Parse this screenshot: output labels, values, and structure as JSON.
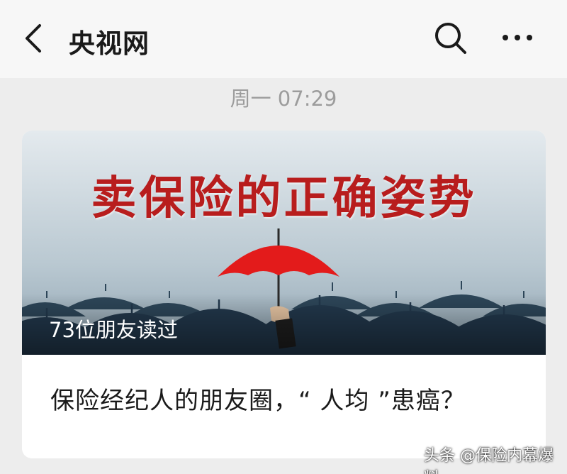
{
  "header": {
    "title": "央视网"
  },
  "icons": {
    "back": "back-chevron-icon",
    "search": "search-icon",
    "more": "more-dots-icon"
  },
  "timestamp": "周一 07:29",
  "article": {
    "cover_heading": "卖保险的正确姿势",
    "read_count": "73位朋友读过",
    "headline": "保险经纪人的朋友圈，“ 人均 ”患癌？"
  },
  "watermark": "头条 @保险内幕爆料",
  "colors": {
    "heading_red": "#b81d1d",
    "umbrella_red": "#e31b1b",
    "umbrella_dark": "#22384c"
  }
}
